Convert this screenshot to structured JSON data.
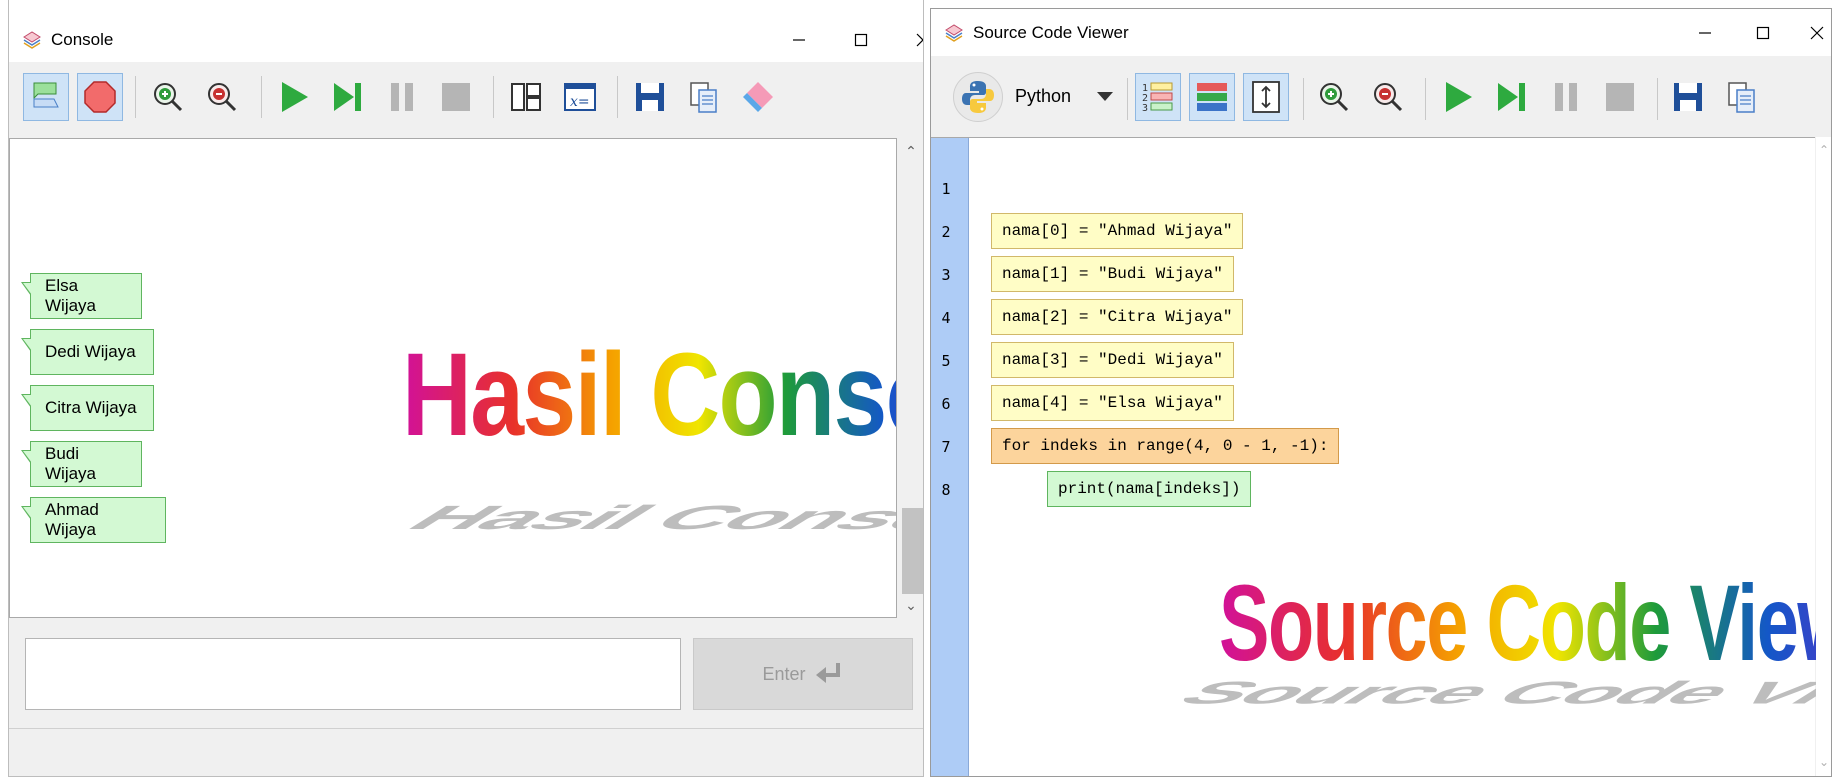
{
  "console": {
    "title": "Console",
    "toolbar": [
      "output-mode-icon",
      "stop-icon",
      "zoom-in-icon",
      "zoom-out-icon",
      "run-icon",
      "step-icon",
      "pause-icon",
      "stop-square-icon",
      "layout-icon",
      "variable-icon",
      "save-icon",
      "copy-icon",
      "eraser-icon"
    ],
    "outputs": [
      "Elsa Wijaya",
      "Dedi Wijaya",
      "Citra Wijaya",
      "Budi Wijaya",
      "Ahmad Wijaya"
    ],
    "banner": "Hasil Console",
    "enter_label": "Enter"
  },
  "viewer": {
    "title": "Source Code Viewer",
    "language": "Python",
    "toolbar": [
      "line-numbers-icon",
      "blocks-icon",
      "fit-icon",
      "zoom-in-icon",
      "zoom-out-icon",
      "run-icon",
      "step-icon",
      "pause-icon",
      "stop-square-icon",
      "save-icon",
      "copy-icon"
    ],
    "line_numbers": [
      "1",
      "2",
      "3",
      "4",
      "5",
      "6",
      "7",
      "8"
    ],
    "code": [
      "nama[0] = \"Ahmad Wijaya\"",
      "nama[1] = \"Budi Wijaya\"",
      "nama[2] = \"Citra Wijaya\"",
      "nama[3] = \"Dedi Wijaya\"",
      "nama[4] = \"Elsa Wijaya\"",
      "for indeks in range(4, 0 - 1, -1):",
      "print(nama[indeks])"
    ],
    "banner": "Source Code Viewer"
  },
  "colors": {
    "statement_block": "#fffdc6",
    "loop_block": "#fcd49c",
    "print_block": "#d3f9d3",
    "gutter": "#aeccf6",
    "active_tool": "#cfe3f7"
  }
}
